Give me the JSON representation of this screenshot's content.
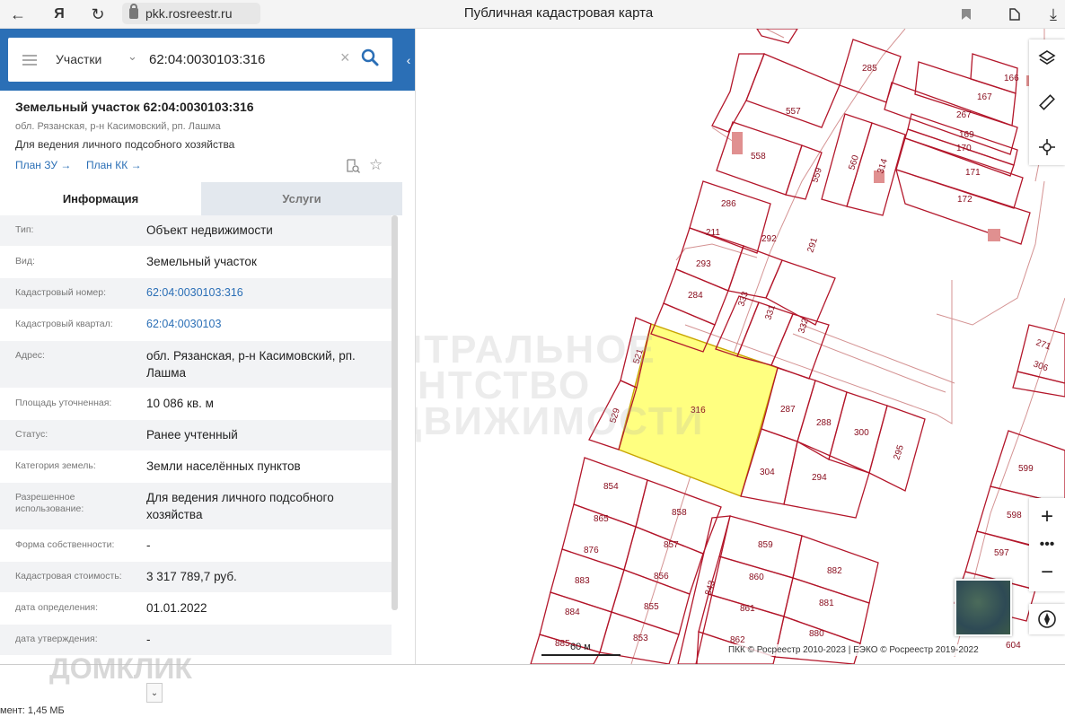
{
  "browser": {
    "url": "pkk.rosreestr.ru",
    "title": "Публичная кадастровая карта"
  },
  "search": {
    "type": "Участки",
    "value": "62:04:0030103:316"
  },
  "object": {
    "title": "Земельный участок 62:04:0030103:316",
    "address": "обл. Рязанская, р-н Касимовский, рп. Лашма",
    "usage": "Для ведения личного подсобного хозяйства",
    "plan_zu": "План ЗУ →",
    "plan_kk": "План КК →"
  },
  "tabs": {
    "info": "Информация",
    "services": "Услуги"
  },
  "info": [
    {
      "label": "Тип:",
      "value": "Объект недвижимости"
    },
    {
      "label": "Вид:",
      "value": "Земельный участок"
    },
    {
      "label": "Кадастровый номер:",
      "value": "62:04:0030103:316"
    },
    {
      "label": "Кадастровый квартал:",
      "value": "62:04:0030103"
    },
    {
      "label": "Адрес:",
      "value": "обл. Рязанская, р-н Касимовский, рп. Лашма"
    },
    {
      "label": "Площадь уточненная:",
      "value": "10 086 кв. м"
    },
    {
      "label": "Статус:",
      "value": "Ранее учтенный"
    },
    {
      "label": "Категория земель:",
      "value": "Земли населённых пунктов"
    },
    {
      "label": "Разрешенное использование:",
      "value": "Для ведения личного подсобного хозяйства"
    },
    {
      "label": "Форма собственности:",
      "value": "-"
    },
    {
      "label": "Кадастровая стоимость:",
      "value": "3 317 789,7 руб."
    },
    {
      "label": "дата определения:",
      "value": "01.01.2022"
    },
    {
      "label": "дата утверждения:",
      "value": "-"
    }
  ],
  "map": {
    "scale": "60 м",
    "attribution": "ПКК © Росреестр 2010-2023 | ЕЭКО © Росреестр 2019-2022",
    "watermark": "ЦЕНТРАЛЬНОЕ АГЕНТСТВО НЕДВИЖИМОСТИ",
    "selected_color": "#ffff80",
    "parcel_color": "#b3162a",
    "parcels": [
      "285",
      "166",
      "167",
      "267",
      "169",
      "170",
      "171",
      "172",
      "557",
      "558",
      "559",
      "560",
      "314",
      "286",
      "211",
      "292",
      "291",
      "293",
      "284",
      "333",
      "331",
      "332",
      "521",
      "316",
      "529",
      "287",
      "288",
      "300",
      "295",
      "304",
      "294",
      "854",
      "858",
      "865",
      "857",
      "876",
      "856",
      "883",
      "855",
      "884",
      "853",
      "885",
      "859",
      "860",
      "882",
      "861",
      "881",
      "880",
      "862",
      "843",
      "599",
      "598",
      "597",
      "271",
      "306",
      "604"
    ]
  },
  "footer": {
    "download_status": "мент: 1,45 МБ",
    "watermark": "ДОМКЛИК"
  }
}
